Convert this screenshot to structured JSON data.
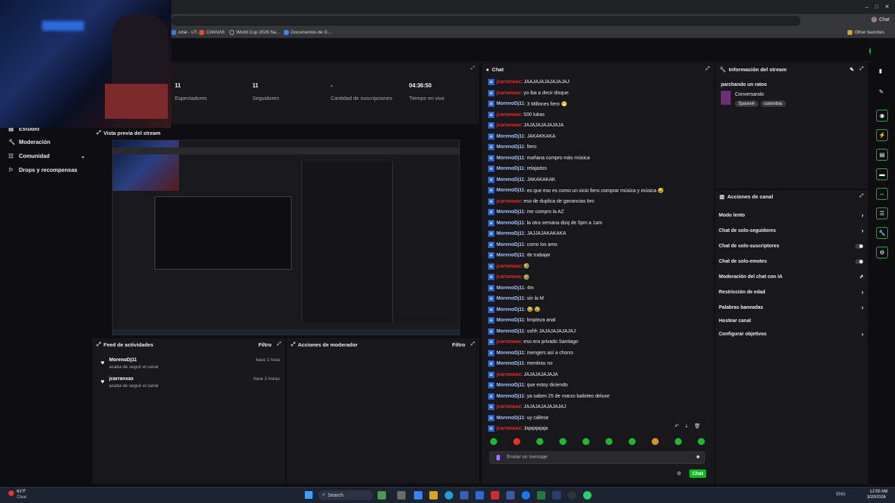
{
  "browser": {
    "bookmarks": [
      {
        "label": "ortal - UT...",
        "icon": "bookmark-icon"
      },
      {
        "label": "CANVAS",
        "icon": "canvas-icon"
      },
      {
        "label": "World Cup 2026 Sa...",
        "icon": "globe-icon"
      },
      {
        "label": "Documentos de G...",
        "icon": "docs-icon"
      }
    ],
    "other_favorites": "Other favorites",
    "chat_tab": "Chat"
  },
  "sidebar": {
    "items": [
      {
        "label": "Estudio",
        "icon": "studio-icon"
      },
      {
        "label": "Moderación",
        "icon": "wrench-icon"
      },
      {
        "label": "Comunidad",
        "icon": "community-icon"
      },
      {
        "label": "Drops y recompensas",
        "icon": "gift-icon"
      }
    ]
  },
  "stats": [
    {
      "value": "11",
      "label": "Espectadores"
    },
    {
      "value": "11",
      "label": "Seguidores"
    },
    {
      "value": "-",
      "label": "Cantidad de suscripciones"
    },
    {
      "value": "04:36:50",
      "label": "Tiempo en vivo"
    }
  ],
  "preview": {
    "title": "Vista previa del stream"
  },
  "activity": {
    "title": "Feed de actividades",
    "filter": "Filtro",
    "items": [
      {
        "name": "MorenoDj11",
        "desc": "acaba de seguir el canal",
        "time": "hace 1 hora"
      },
      {
        "name": "jcarranxax",
        "desc": "acaba de seguir el canal",
        "time": "hace 2 horas"
      }
    ]
  },
  "mod_actions": {
    "title": "Acciones de moderador",
    "filter": "Filtro"
  },
  "chat": {
    "title": "Chat",
    "messages": [
      {
        "user": "jcarranxax",
        "kind": "j",
        "text": ": JAAJAJAJAJAJAJAJ"
      },
      {
        "user": "jcarranxax",
        "kind": "j",
        "text": ": yo iba a decir disque"
      },
      {
        "user": "MorenoDj11",
        "kind": "m",
        "text": ": 3 Millones fiero 😁"
      },
      {
        "user": "jcarranxax",
        "kind": "j",
        "text": ": 500 lukas"
      },
      {
        "user": "jcarranxax",
        "kind": "j",
        "text": ": JAJAJAJAJAJAJA"
      },
      {
        "user": "MorenoDj11",
        "kind": "m",
        "text": ": JAKAKKAKA"
      },
      {
        "user": "MorenoDj11",
        "kind": "m",
        "text": ": fiero"
      },
      {
        "user": "MorenoDj11",
        "kind": "m",
        "text": ": mañana compro más música"
      },
      {
        "user": "MorenoDj11",
        "kind": "m",
        "text": ": relajados"
      },
      {
        "user": "MorenoDj11",
        "kind": "m",
        "text": ": JAKAKAKAK"
      },
      {
        "user": "MorenoDj11",
        "kind": "m",
        "text": ": es que eso es como un vicio fiero comprar música y música 😅"
      },
      {
        "user": "jcarranxax",
        "kind": "j",
        "text": ": eso de duplica de ganancias bro"
      },
      {
        "user": "MorenoDj11",
        "kind": "m",
        "text": ": me compro la AZ"
      },
      {
        "user": "MorenoDj11",
        "kind": "m",
        "text": ": la otra semana dizq de 5pm a 1am"
      },
      {
        "user": "MorenoDj11",
        "kind": "m",
        "text": ": JAJJAJAKAKAKA"
      },
      {
        "user": "MorenoDj11",
        "kind": "m",
        "text": ": como los amo"
      },
      {
        "user": "MorenoDj11",
        "kind": "m",
        "text": ": de trabajar"
      },
      {
        "user": "jcarranxax",
        "kind": "j",
        "text": ": 🤣"
      },
      {
        "user": "jcarranxax",
        "kind": "j",
        "text": ": 🤣"
      },
      {
        "user": "MorenoDj11",
        "kind": "m",
        "text": ": 4m"
      },
      {
        "user": "MorenoDj11",
        "kind": "m",
        "text": ": sin la M"
      },
      {
        "user": "MorenoDj11",
        "kind": "m",
        "text": ": 😂 😂"
      },
      {
        "user": "MorenoDj11",
        "kind": "m",
        "text": ": limpieza anal"
      },
      {
        "user": "MorenoDj11",
        "kind": "m",
        "text": ": ushh JAJAJAJAJAJAJ"
      },
      {
        "user": "jcarranxax",
        "kind": "j",
        "text": ": eso era privado Santiago"
      },
      {
        "user": "MorenoDj11",
        "kind": "m",
        "text": ": mengers así a chorro"
      },
      {
        "user": "MorenoDj11",
        "kind": "m",
        "text": ": mentiras no"
      },
      {
        "user": "jcarranxax",
        "kind": "j",
        "text": ": JAJAJAJAJAJA"
      },
      {
        "user": "MorenoDj11",
        "kind": "m",
        "text": ": que estoy diciendo"
      },
      {
        "user": "MorenoDj11",
        "kind": "m",
        "text": ": ya saben 25 de marzo bailoteo deluxe"
      },
      {
        "user": "jcarranxax",
        "kind": "j",
        "text": ": JAJAJAJAJAJAJAJ"
      },
      {
        "user": "MorenoDj11",
        "kind": "m",
        "text": ": uy cállese"
      },
      {
        "user": "jcarranxax",
        "kind": "j",
        "text": ": Jajajajajaja"
      }
    ],
    "input_placeholder": "Enviar un mensaje",
    "send_label": "Chat"
  },
  "stream_info": {
    "title": "Información del stream",
    "stream_title": "parchando un ratoo",
    "category": "Conversando",
    "tags": [
      "Spanish",
      "colombia"
    ]
  },
  "channel_actions": {
    "title": "Acciones de canal",
    "items": [
      {
        "label": "Modo lento",
        "control": "chevron"
      },
      {
        "label": "Chat de solo-seguidores",
        "control": "chevron"
      },
      {
        "label": "Chat de solo-suscriptores",
        "control": "toggle"
      },
      {
        "label": "Chat de solo-emotes",
        "control": "toggle"
      },
      {
        "label": "Moderación del chat con IA",
        "control": "external"
      },
      {
        "label": "Restricción de edad",
        "control": "chevron"
      },
      {
        "label": "Palabras baneadas",
        "control": "chevron"
      },
      {
        "label": "Hostear canal",
        "control": "none"
      },
      {
        "label": "Configurar objetivos",
        "control": "chevron"
      }
    ]
  },
  "taskbar": {
    "search": "Search",
    "time": "12:50 AM",
    "date": "3/20/2026",
    "weather_temp": "61°F",
    "weather_desc": "Clear",
    "lang": "ENG"
  },
  "colors": {
    "accent_green": "#1fb830",
    "badge_blue": "#2a62c8",
    "user_red": "#e0312b",
    "user_blue": "#a8c4ff"
  }
}
